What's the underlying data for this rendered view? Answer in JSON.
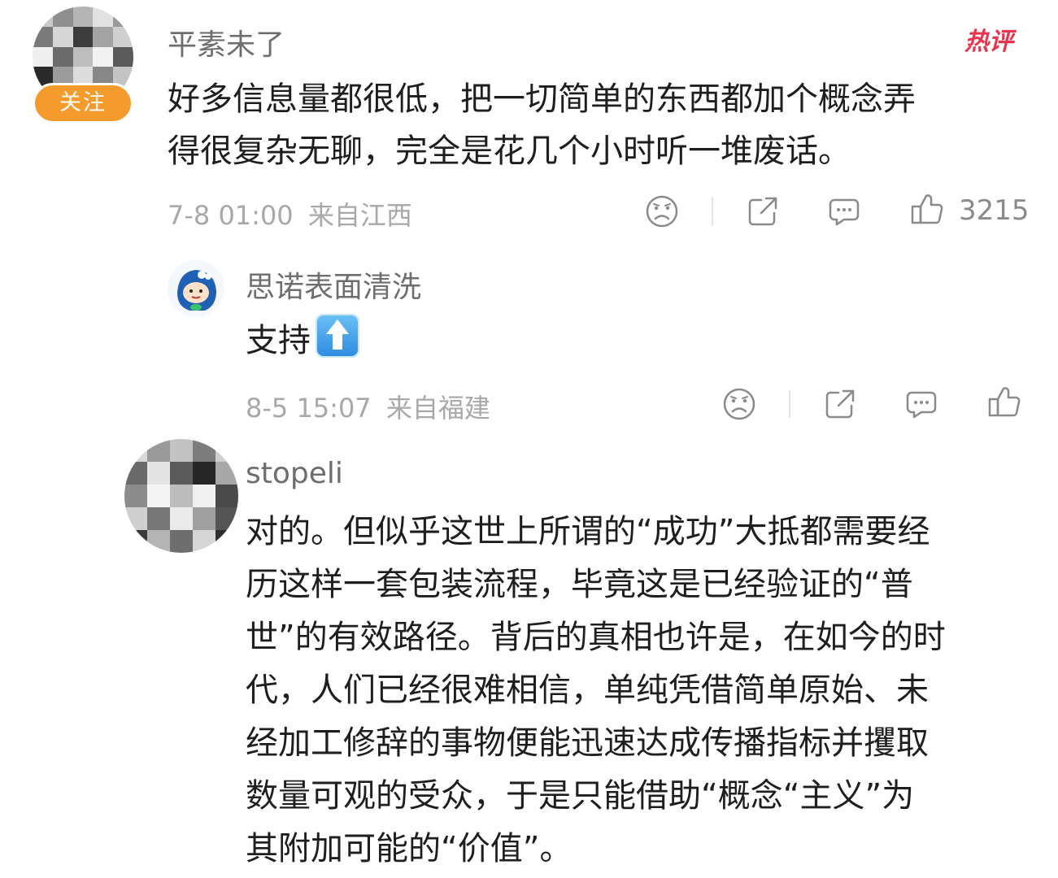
{
  "comments": [
    {
      "username": "平素未了",
      "follow_label": "关注",
      "hot_label": "热评",
      "lines": [
        "好多信息量都很低，把一切简单的东西都加个概念弄",
        "得很复杂无聊，完全是花几个小时听一堆废话。"
      ],
      "timestamp": "7-8 01:00",
      "location": "来自江西",
      "like_count": "3215",
      "icons": [
        "frown-icon",
        "share-icon",
        "comment-icon",
        "like-icon"
      ]
    },
    {
      "username": "思诺表面清洗",
      "text": "支持",
      "emoji": "up-arrow-emoji",
      "timestamp": "8-5 15:07",
      "location": "来自福建",
      "icons": [
        "frown-icon",
        "share-icon",
        "comment-icon",
        "like-icon"
      ]
    },
    {
      "username": "stopeli",
      "lines": [
        "对的。但似乎这世上所谓的“成功”大抵都需要经",
        "历这样一套包装流程，毕竟这是已经验证的“普",
        "世”的有效路径。背后的真相也许是，在如今的时",
        "代，人们已经很难相信，单纯凭借简单原始、未",
        "经加工修辞的事物便能迅速达成传播指标并攫取",
        "数量可观的受众，于是只能借助“概念“主义”为",
        "其附加可能的“价值”。"
      ]
    }
  ],
  "colors": {
    "follow_badge": "#f59a2c",
    "hot_tag": "#e8344e",
    "meta_text": "#a8a8a8",
    "username": "#6e6e6e"
  }
}
